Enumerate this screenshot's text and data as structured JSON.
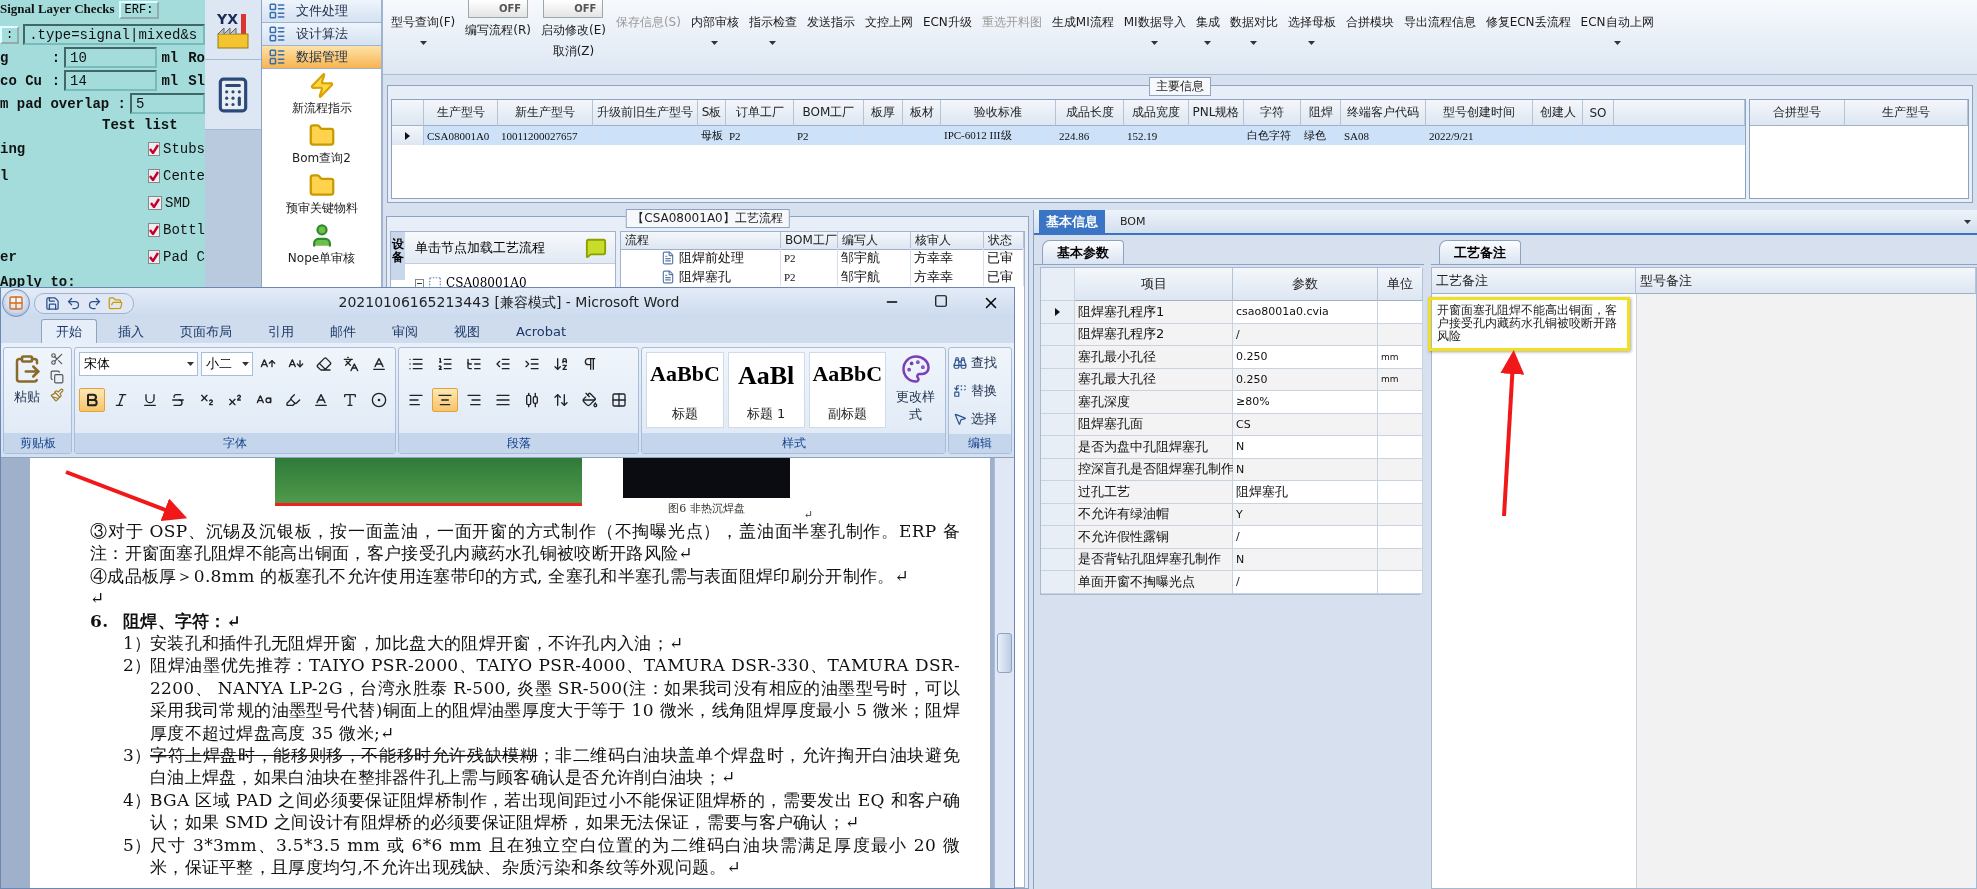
{
  "back_window": {
    "title": "Signal Layer Checks",
    "erf_button": "ERF:",
    "colon_button": ":",
    "filter": ".type=signal|mixed&s",
    "params": [
      {
        "label": "g",
        "sep": ":",
        "value": "10",
        "unit": "ml",
        "next": "Ro"
      },
      {
        "label": "co Cu",
        "sep": ":",
        "value": "14",
        "unit": "ml",
        "next": "Sl"
      }
    ],
    "overlap": {
      "label": "m pad overlap :",
      "value": "5"
    },
    "test_list_title": "Test list",
    "tests": [
      {
        "left": "ing",
        "label": "Stubs",
        "checked": true
      },
      {
        "left": "l",
        "label": "Cente",
        "checked": true
      },
      {
        "label": "SMD",
        "checked": true
      },
      {
        "label": "Bottl",
        "checked": true
      },
      {
        "left": "er",
        "label": "Pad C",
        "checked": true
      }
    ],
    "apply_to": "Apply to:"
  },
  "nav": {
    "logo_text": "YX",
    "sections": [
      {
        "label": "文件处理",
        "selected": false
      },
      {
        "label": "设计算法",
        "selected": false
      },
      {
        "label": "数据管理",
        "selected": true
      }
    ],
    "items": [
      {
        "label": "新流程指示",
        "kind": "lightning"
      },
      {
        "label": "Bom查询2",
        "kind": "folder"
      },
      {
        "label": "预审关键物料",
        "kind": "folder"
      },
      {
        "label": "Nope单审核",
        "kind": "person"
      }
    ]
  },
  "toolbar": [
    {
      "kind": "button",
      "label": "型号查询(F)",
      "dropdown": true,
      "disabled": false
    },
    {
      "kind": "toggle",
      "switch_text": "OFF",
      "on": false,
      "label": "编写流程(R)"
    },
    {
      "kind": "toggle",
      "switch_text": "OFF",
      "on": false,
      "label": "启动修改(E)",
      "extra": "取消(Z)"
    },
    {
      "kind": "button",
      "label": "保存信息(S)",
      "dropdown": false,
      "disabled": true
    },
    {
      "kind": "button",
      "label": "内部审核",
      "dropdown": true,
      "disabled": false
    },
    {
      "kind": "button",
      "label": "指示检查",
      "dropdown": true,
      "disabled": false
    },
    {
      "kind": "button",
      "label": "发送指示",
      "dropdown": false,
      "disabled": false
    },
    {
      "kind": "button",
      "label": "文控上网",
      "dropdown": false,
      "disabled": false
    },
    {
      "kind": "button",
      "label": "ECN升级",
      "dropdown": false,
      "disabled": false
    },
    {
      "kind": "button",
      "label": "重选开料图",
      "dropdown": false,
      "disabled": true
    },
    {
      "kind": "button",
      "label": "生成MI流程",
      "dropdown": false,
      "disabled": false
    },
    {
      "kind": "button",
      "label": "MI数据导入",
      "dropdown": true,
      "disabled": false
    },
    {
      "kind": "button",
      "label": "集成",
      "dropdown": true,
      "disabled": false
    },
    {
      "kind": "button",
      "label": "数据对比",
      "dropdown": true,
      "disabled": false
    },
    {
      "kind": "button",
      "label": "选择母板",
      "dropdown": true,
      "disabled": false
    },
    {
      "kind": "button",
      "label": "合拼模块",
      "dropdown": false,
      "disabled": false
    },
    {
      "kind": "button",
      "label": "导出流程信息",
      "dropdown": false,
      "disabled": false
    },
    {
      "kind": "button",
      "label": "修复ECN丢流程",
      "dropdown": false,
      "disabled": false
    },
    {
      "kind": "button",
      "label": "ECN自动上网",
      "dropdown": true,
      "disabled": false
    }
  ],
  "main_info": {
    "title": "主要信息",
    "columns": [
      "生产型号",
      "新生产型号",
      "升级前旧生产型号",
      "S板",
      "订单工厂",
      "BOM工厂",
      "板厚",
      "板材",
      "验收标准",
      "成品长度",
      "成品宽度",
      "PNL规格",
      "字符",
      "阻焊",
      "终端客户代码",
      "型号创建时间",
      "创建人",
      "SO"
    ],
    "rows": [
      {
        "selected": true,
        "cells": [
          "CSA08001A0",
          "10011200027657",
          "",
          "母板",
          "P2",
          "P2",
          "",
          "",
          "IPC-6012 III级",
          "224.86",
          "152.19",
          "",
          "白色字符",
          "绿色",
          "SA08",
          "2022/9/21",
          "",
          ""
        ]
      }
    ],
    "side_columns": [
      "合拼型号",
      "生产型号"
    ]
  },
  "process": {
    "title": "【CSA08001A0】工艺流程",
    "side_tab": "设备",
    "hint": "单击节点加载工艺流程",
    "tree_root": "CSA08001A0",
    "columns": [
      "流程",
      "BOM工厂",
      "编写人",
      "核审人",
      "状态"
    ],
    "rows": [
      [
        "阻焊前处理",
        "P2",
        "邹宇航",
        "方幸幸",
        "已审"
      ],
      [
        "阻焊塞孔",
        "P2",
        "邹宇航",
        "方幸幸",
        "已审"
      ]
    ]
  },
  "info_panel": {
    "tabs": [
      {
        "label": "基本信息",
        "selected": true
      },
      {
        "label": "BOM",
        "selected": false
      }
    ],
    "params_tab": "基本参数",
    "columns": [
      "项目",
      "参数",
      "单位"
    ],
    "rows": [
      {
        "item": "阻焊塞孔程序1",
        "value": "csao8001a0.cvia",
        "selected": true
      },
      {
        "item": "阻焊塞孔程序2",
        "value": "/",
        "selected": false
      },
      {
        "item": "塞孔最小孔径",
        "value": "0.250",
        "unit": "mm",
        "selected": false
      },
      {
        "item": "塞孔最大孔径",
        "value": "0.250",
        "unit": "mm",
        "selected": false
      },
      {
        "item": "塞孔深度",
        "value": "≥80%",
        "selected": false
      },
      {
        "item": "阻焊塞孔面",
        "value": "CS",
        "selected": false
      },
      {
        "item": "是否为盘中孔阻焊塞孔",
        "value": "N",
        "selected": false
      },
      {
        "item": "控深盲孔是否阻焊塞孔制作",
        "value": "N",
        "selected": false
      },
      {
        "item": "过孔工艺",
        "value": "阻焊塞孔",
        "selected": false
      },
      {
        "item": "不允许有绿油帽",
        "value": "Y",
        "selected": false
      },
      {
        "item": "不允许假性露铜",
        "value": "/",
        "selected": false
      },
      {
        "item": "是否背钻孔阻焊塞孔制作",
        "value": "N",
        "selected": false
      },
      {
        "item": "单面开窗不掏曝光点",
        "value": "/",
        "selected": false
      }
    ],
    "notes_tab": "工艺备注",
    "notes_columns": [
      "工艺备注",
      "型号备注"
    ],
    "note": "开窗面塞孔阻焊不能高出铜面，客户接受孔内藏药水孔铜被咬断开路风险"
  },
  "word": {
    "title": "20210106165213443 [兼容模式] - Microsoft Word",
    "tabs": [
      {
        "label": "开始",
        "selected": true
      },
      {
        "label": "插入",
        "selected": false
      },
      {
        "label": "页面布局",
        "selected": false
      },
      {
        "label": "引用",
        "selected": false
      },
      {
        "label": "邮件",
        "selected": false
      },
      {
        "label": "审阅",
        "selected": false
      },
      {
        "label": "视图",
        "selected": false
      },
      {
        "label": "Acrobat",
        "selected": false
      }
    ],
    "paste": "粘贴",
    "font_name": "宋体",
    "font_size": "小二",
    "font_buttons": [
      {
        "kind": "bold",
        "selected": true
      },
      {
        "kind": "italic",
        "selected": false
      },
      {
        "kind": "underline",
        "selected": false
      },
      {
        "kind": "strike",
        "selected": false
      },
      {
        "kind": "sub",
        "selected": false
      },
      {
        "kind": "sup",
        "selected": false
      },
      {
        "kind": "case",
        "selected": false
      },
      {
        "kind": "highlight",
        "selected": false
      },
      {
        "kind": "color",
        "selected": false
      },
      {
        "kind": "shade",
        "selected": false
      },
      {
        "kind": "enclose",
        "selected": false
      }
    ],
    "align_buttons": [
      {
        "kind": "left",
        "selected": false
      },
      {
        "kind": "center",
        "selected": true
      },
      {
        "kind": "right",
        "selected": false
      },
      {
        "kind": "justify",
        "selected": false
      },
      {
        "kind": "distribute",
        "selected": false
      }
    ],
    "styles": [
      {
        "sample": "AaBbC",
        "label": "标题",
        "kind": "title"
      },
      {
        "sample": "AaBl",
        "label": "标题 1",
        "kind": "heading"
      },
      {
        "sample": "AaBbC",
        "label": "副标题",
        "kind": "subtitle"
      }
    ],
    "change_styles": "更改样式",
    "edit_buttons": [
      {
        "kind": "find",
        "label": "查找"
      },
      {
        "kind": "replace",
        "label": "替换"
      },
      {
        "kind": "select",
        "label": "选择"
      }
    ],
    "groups": [
      "剪贴板",
      "字体",
      "段落",
      "样式",
      "编辑"
    ],
    "caption": "图6 非热沉焊盘",
    "caption_mark": "↵",
    "paragraphs": [
      {
        "kind": "text",
        "text": "③对于 OSP、沉锡及沉银板，按一面盖油，一面开窗的方式制作（不掏曝光点），盖油面半塞孔制作。ERP 备注：开窗面塞孔阻焊不能高出铜面，客户接受孔内藏药水孔铜被咬断开路风险↵"
      },
      {
        "kind": "text",
        "text": "④成品板厚＞0.8mm 的板塞孔不允许使用连塞带印的方式, 全塞孔和半塞孔需与表面阻焊印刷分开制作。↵"
      },
      {
        "kind": "text",
        "text": "↵"
      },
      {
        "kind": "heading",
        "number": "6.",
        "text": "阻焊、字符：↵"
      },
      {
        "kind": "item",
        "number": "1）",
        "segments": [
          {
            "text": "安装孔和插件孔无阻焊开窗，加比盘大的阻焊开窗，不许孔内入油；↵",
            "struck": false
          }
        ]
      },
      {
        "kind": "item",
        "number": "2）",
        "segments": [
          {
            "text": "阻焊油墨优先推荐：TAIYO PSR-2000、TAIYO PSR-4000、TAMURA  DSR-330、TAMURA DSR-2200、 NANYA LP-2G，台湾永胜泰 R-500, 炎墨 SR-500(注：如果我司没有相应的油墨型号时，可以采用我司常规的油墨型号代替)铜面上的阻焊油墨厚度大于等于 10 微米，线角阻焊厚度最小 5 微米；阻焊厚度不超过焊盘高度 35 微米;↵",
            "struck": false
          }
        ]
      },
      {
        "kind": "item",
        "number": "3）",
        "segments": [
          {
            "text": "字符上焊盘时，能移则移，不能移时允许残缺模糊",
            "struck": true
          },
          {
            "text": "；非二维码白油块盖单个焊盘时，允许掏开白油块避免白油上焊盘，如果白油块在整排器件孔上需与顾客确认是否允许削白油块；↵",
            "struck": false
          }
        ]
      },
      {
        "kind": "item",
        "number": "4）",
        "segments": [
          {
            "text": "BGA 区域 PAD 之间必须要保证阻焊桥制作，若出现间距过小不能保证阻焊桥的，需要发出 EQ 和客户确认；如果 SMD 之间设计有阻焊桥的必须要保证阻焊桥，如果无法保证，需要与客户确认；↵",
            "struck": false
          }
        ]
      },
      {
        "kind": "item",
        "number": "5）",
        "segments": [
          {
            "text": "尺寸 3*3mm、3.5*3.5 mm 或 6*6 mm 且在独立空白位置的为二维码白油块需满足厚度最小 20 微米，保证平整，且厚度均匀,不允许出现残缺、杂质污染和条纹等外观问题。↵",
            "struck": false
          }
        ]
      }
    ]
  }
}
